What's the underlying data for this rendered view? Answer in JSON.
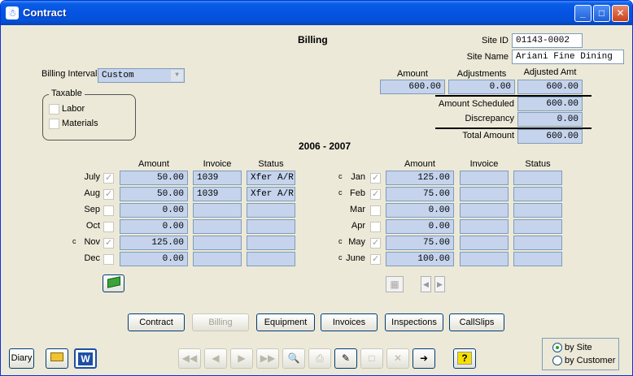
{
  "window": {
    "title": "Contract",
    "icon": "app-icon"
  },
  "header": {
    "section_title": "Billing",
    "site_id_label": "Site ID",
    "site_id": "01143-0002",
    "site_name_label": "Site Name",
    "site_name": "Ariani Fine Dining"
  },
  "billing_interval": {
    "label": "Billing Interval",
    "value": "Custom"
  },
  "taxable": {
    "label": "Taxable",
    "labor": "Labor",
    "materials": "Materials",
    "labor_checked": false,
    "materials_checked": false
  },
  "summary": {
    "amount_label": "Amount",
    "adjustments_label": "Adjustments",
    "adjusted_label": "Adjusted Amt",
    "amount": "600.00",
    "adjustments": "0.00",
    "adjusted": "600.00",
    "scheduled_label": "Amount Scheduled",
    "scheduled": "600.00",
    "discrepancy_label": "Discrepancy",
    "discrepancy": "0.00",
    "total_label": "Total Amount",
    "total": "600.00"
  },
  "period_title": "2006 - 2007",
  "columns": {
    "amount": "Amount",
    "invoice": "Invoice",
    "status": "Status"
  },
  "months_left": [
    {
      "prefix": "",
      "month": "July",
      "checked": true,
      "amount": "50.00",
      "invoice": "1039",
      "status": "Xfer A/R"
    },
    {
      "prefix": "",
      "month": "Aug",
      "checked": true,
      "amount": "50.00",
      "invoice": "1039",
      "status": "Xfer A/R"
    },
    {
      "prefix": "",
      "month": "Sep",
      "checked": false,
      "amount": "0.00",
      "invoice": "",
      "status": ""
    },
    {
      "prefix": "",
      "month": "Oct",
      "checked": false,
      "amount": "0.00",
      "invoice": "",
      "status": ""
    },
    {
      "prefix": "c",
      "month": "Nov",
      "checked": true,
      "amount": "125.00",
      "invoice": "",
      "status": ""
    },
    {
      "prefix": "",
      "month": "Dec",
      "checked": false,
      "amount": "0.00",
      "invoice": "",
      "status": ""
    }
  ],
  "months_right": [
    {
      "prefix": "c",
      "month": "Jan",
      "checked": true,
      "amount": "125.00",
      "invoice": "",
      "status": ""
    },
    {
      "prefix": "c",
      "month": "Feb",
      "checked": true,
      "amount": "75.00",
      "invoice": "",
      "status": ""
    },
    {
      "prefix": "",
      "month": "Mar",
      "checked": false,
      "amount": "0.00",
      "invoice": "",
      "status": ""
    },
    {
      "prefix": "",
      "month": "Apr",
      "checked": false,
      "amount": "0.00",
      "invoice": "",
      "status": ""
    },
    {
      "prefix": "c",
      "month": "May",
      "checked": true,
      "amount": "75.00",
      "invoice": "",
      "status": ""
    },
    {
      "prefix": "c",
      "month": "June",
      "checked": true,
      "amount": "100.00",
      "invoice": "",
      "status": ""
    }
  ],
  "nav_tabs": [
    "Contract",
    "Billing",
    "Equipment",
    "Invoices",
    "Inspections",
    "CallSlips"
  ],
  "bottom": {
    "diary": "Diary",
    "word_letter": "W",
    "help": "?"
  },
  "view_by": {
    "by_site": "by Site",
    "by_customer": "by Customer",
    "selected": "by Site"
  },
  "colors": {
    "field_bg": "#c5d3ec",
    "title_bar": "#0554e3",
    "window_bg": "#ece9d8"
  }
}
